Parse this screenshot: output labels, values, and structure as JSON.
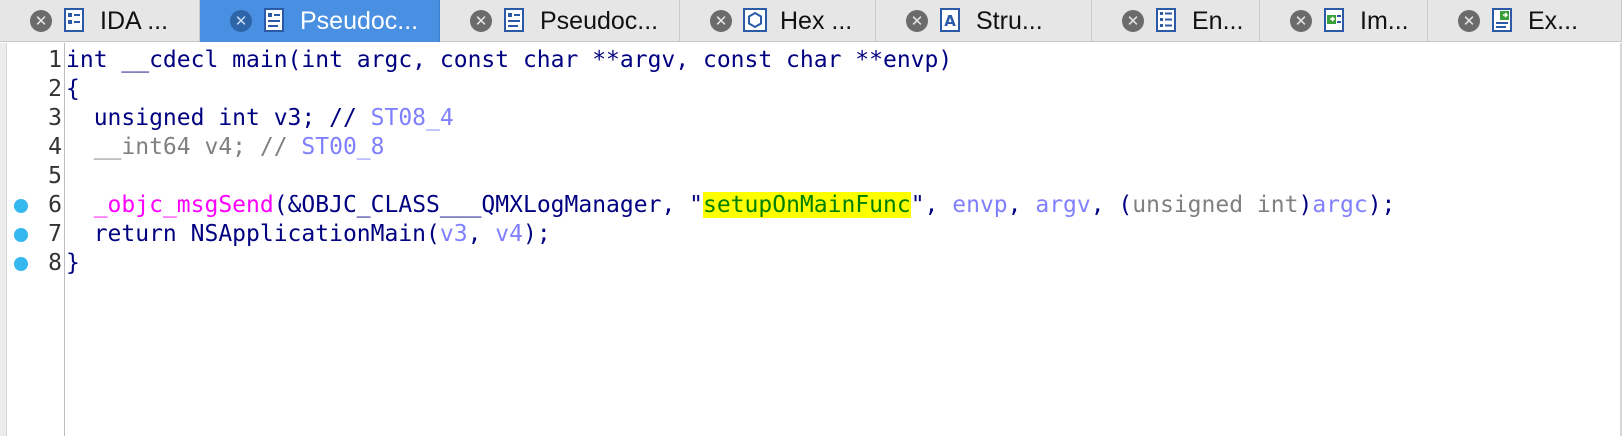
{
  "tabs": [
    {
      "label": "IDA ...",
      "icon": "ida-view-icon",
      "active": false
    },
    {
      "label": "Pseudoc...",
      "icon": "pseudocode-icon",
      "active": true
    },
    {
      "label": "Pseudoc...",
      "icon": "pseudocode-icon",
      "active": false
    },
    {
      "label": "Hex ...",
      "icon": "hex-view-icon",
      "active": false
    },
    {
      "label": "Stru...",
      "icon": "structures-icon",
      "active": false
    },
    {
      "label": "En...",
      "icon": "enums-icon",
      "active": false
    },
    {
      "label": "Im...",
      "icon": "imports-icon",
      "active": false
    },
    {
      "label": "Ex...",
      "icon": "exports-icon",
      "active": false
    }
  ],
  "close_glyph": "⊗",
  "colors": {
    "accent_tab": "#4a90e2",
    "keyword": "#000080",
    "function_call": "#ff00ff",
    "stack_var": "#8080ff",
    "string": "#008000",
    "string_highlight": "#ffff00",
    "breakpoint": "#35b8f0"
  },
  "code": {
    "lines": [
      {
        "num": "1",
        "breakpoint": false,
        "tokens": [
          {
            "t": "int __cdecl main(int argc, const char **argv, const char **envp)",
            "c": "kw"
          }
        ]
      },
      {
        "num": "2",
        "breakpoint": false,
        "tokens": [
          {
            "t": "{",
            "c": "plain"
          }
        ]
      },
      {
        "num": "3",
        "breakpoint": false,
        "tokens": [
          {
            "t": "  unsigned int v3; // ",
            "c": "kw"
          },
          {
            "t": "ST08_4",
            "c": "stack"
          }
        ]
      },
      {
        "num": "4",
        "breakpoint": false,
        "tokens": [
          {
            "t": "  __int64 v4; // ",
            "c": "grey"
          },
          {
            "t": "ST00_8",
            "c": "stack"
          }
        ]
      },
      {
        "num": "5",
        "breakpoint": false,
        "tokens": []
      },
      {
        "num": "6",
        "breakpoint": true,
        "tokens": [
          {
            "t": "  ",
            "c": "plain"
          },
          {
            "t": "_objc_msgSend",
            "c": "fn"
          },
          {
            "t": "(&OBJC_CLASS___QMXLogManager, \"",
            "c": "plain"
          },
          {
            "t": "setupOnMainFunc",
            "c": "hl"
          },
          {
            "t": "\", ",
            "c": "plain"
          },
          {
            "t": "envp",
            "c": "var"
          },
          {
            "t": ", ",
            "c": "plain"
          },
          {
            "t": "argv",
            "c": "var"
          },
          {
            "t": ", (",
            "c": "plain"
          },
          {
            "t": "unsigned int",
            "c": "grey"
          },
          {
            "t": ")",
            "c": "plain"
          },
          {
            "t": "argc",
            "c": "var"
          },
          {
            "t": ");",
            "c": "plain"
          }
        ]
      },
      {
        "num": "7",
        "breakpoint": true,
        "tokens": [
          {
            "t": "  return NSApplicationMain(",
            "c": "plain"
          },
          {
            "t": "v3",
            "c": "var"
          },
          {
            "t": ", ",
            "c": "plain"
          },
          {
            "t": "v4",
            "c": "var"
          },
          {
            "t": ");",
            "c": "plain"
          }
        ]
      },
      {
        "num": "8",
        "breakpoint": true,
        "tokens": [
          {
            "t": "}",
            "c": "plain"
          }
        ]
      }
    ]
  }
}
